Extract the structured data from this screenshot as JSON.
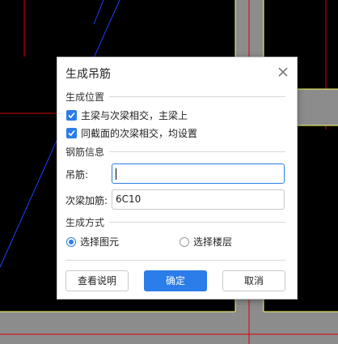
{
  "dialog": {
    "title": "生成吊筋",
    "section_position": "生成位置",
    "check_main_secondary": "主梁与次梁相交，主梁上",
    "check_same_section": "同截面的次梁相交，均设置",
    "section_rebar": "钢筋信息",
    "hanger_label": "吊筋:",
    "hanger_value": "",
    "secondary_label": "次梁加筋:",
    "secondary_value": "6C10",
    "section_method": "生成方式",
    "radio_select_element": "选择图元",
    "radio_select_floor": "选择楼层",
    "btn_help": "查看说明",
    "btn_ok": "确定",
    "btn_cancel": "取消"
  },
  "colors": {
    "accent": "#2b7de9",
    "background": "#000000",
    "wall": "#8c8c8c",
    "wall_edge": "#ffff66",
    "axis_line": "#e00000",
    "diag_line": "#1f3fff"
  },
  "icons": {
    "close": "close-icon",
    "check": "check-icon"
  }
}
